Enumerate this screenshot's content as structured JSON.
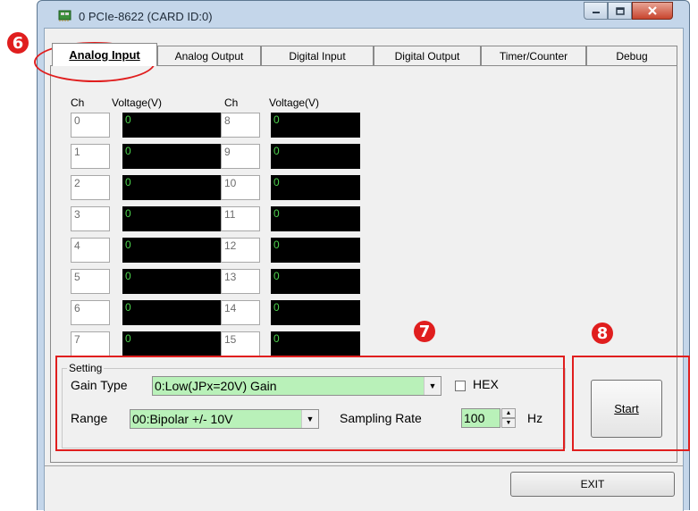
{
  "window": {
    "title": "0 PCIe-8622 (CARD ID:0)"
  },
  "tabs": [
    {
      "label": "Analog Input",
      "active": true
    },
    {
      "label": "Analog Output"
    },
    {
      "label": "Digital Input"
    },
    {
      "label": "Digital Output"
    },
    {
      "label": "Timer/Counter"
    },
    {
      "label": "Debug"
    }
  ],
  "channels": {
    "header_ch": "Ch",
    "header_voltage": "Voltage(V)",
    "left": [
      {
        "ch": "0",
        "v": "0"
      },
      {
        "ch": "1",
        "v": "0"
      },
      {
        "ch": "2",
        "v": "0"
      },
      {
        "ch": "3",
        "v": "0"
      },
      {
        "ch": "4",
        "v": "0"
      },
      {
        "ch": "5",
        "v": "0"
      },
      {
        "ch": "6",
        "v": "0"
      },
      {
        "ch": "7",
        "v": "0"
      }
    ],
    "right": [
      {
        "ch": "8",
        "v": "0"
      },
      {
        "ch": "9",
        "v": "0"
      },
      {
        "ch": "10",
        "v": "0"
      },
      {
        "ch": "11",
        "v": "0"
      },
      {
        "ch": "12",
        "v": "0"
      },
      {
        "ch": "13",
        "v": "0"
      },
      {
        "ch": "14",
        "v": "0"
      },
      {
        "ch": "15",
        "v": "0"
      }
    ]
  },
  "setting": {
    "group_label": "Setting",
    "gain_type_label": "Gain Type",
    "gain_type_value": "0:Low(JPx=20V) Gain",
    "hex_label": "HEX",
    "hex_checked": false,
    "range_label": "Range",
    "range_value": "00:Bipolar +/- 10V",
    "sampling_rate_label": "Sampling Rate",
    "sampling_rate_value": "100",
    "sampling_rate_unit": "Hz"
  },
  "start_button": "Start",
  "exit_button": "EXIT",
  "annotations": [
    "6",
    "7",
    "8"
  ],
  "colors": {
    "voltage_bg": "#000000",
    "voltage_text": "#4dd24d",
    "input_bg": "#b9f1b9",
    "annotation": "#e01e1e"
  }
}
